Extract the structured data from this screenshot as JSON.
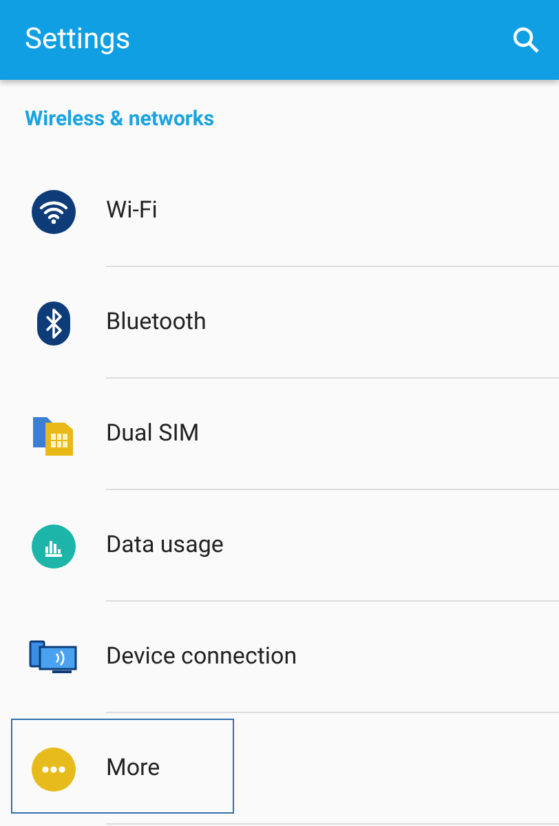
{
  "app_bar": {
    "title": "Settings"
  },
  "section": {
    "title": "Wireless & networks"
  },
  "items": [
    {
      "kind": "wifi",
      "label": "Wi-Fi",
      "focused": false
    },
    {
      "kind": "bluetooth",
      "label": "Bluetooth",
      "focused": false
    },
    {
      "kind": "sim",
      "label": "Dual SIM",
      "focused": false
    },
    {
      "kind": "data",
      "label": "Data usage",
      "focused": false
    },
    {
      "kind": "device",
      "label": "Device connection",
      "focused": false
    },
    {
      "kind": "more",
      "label": "More",
      "focused": true
    }
  ]
}
